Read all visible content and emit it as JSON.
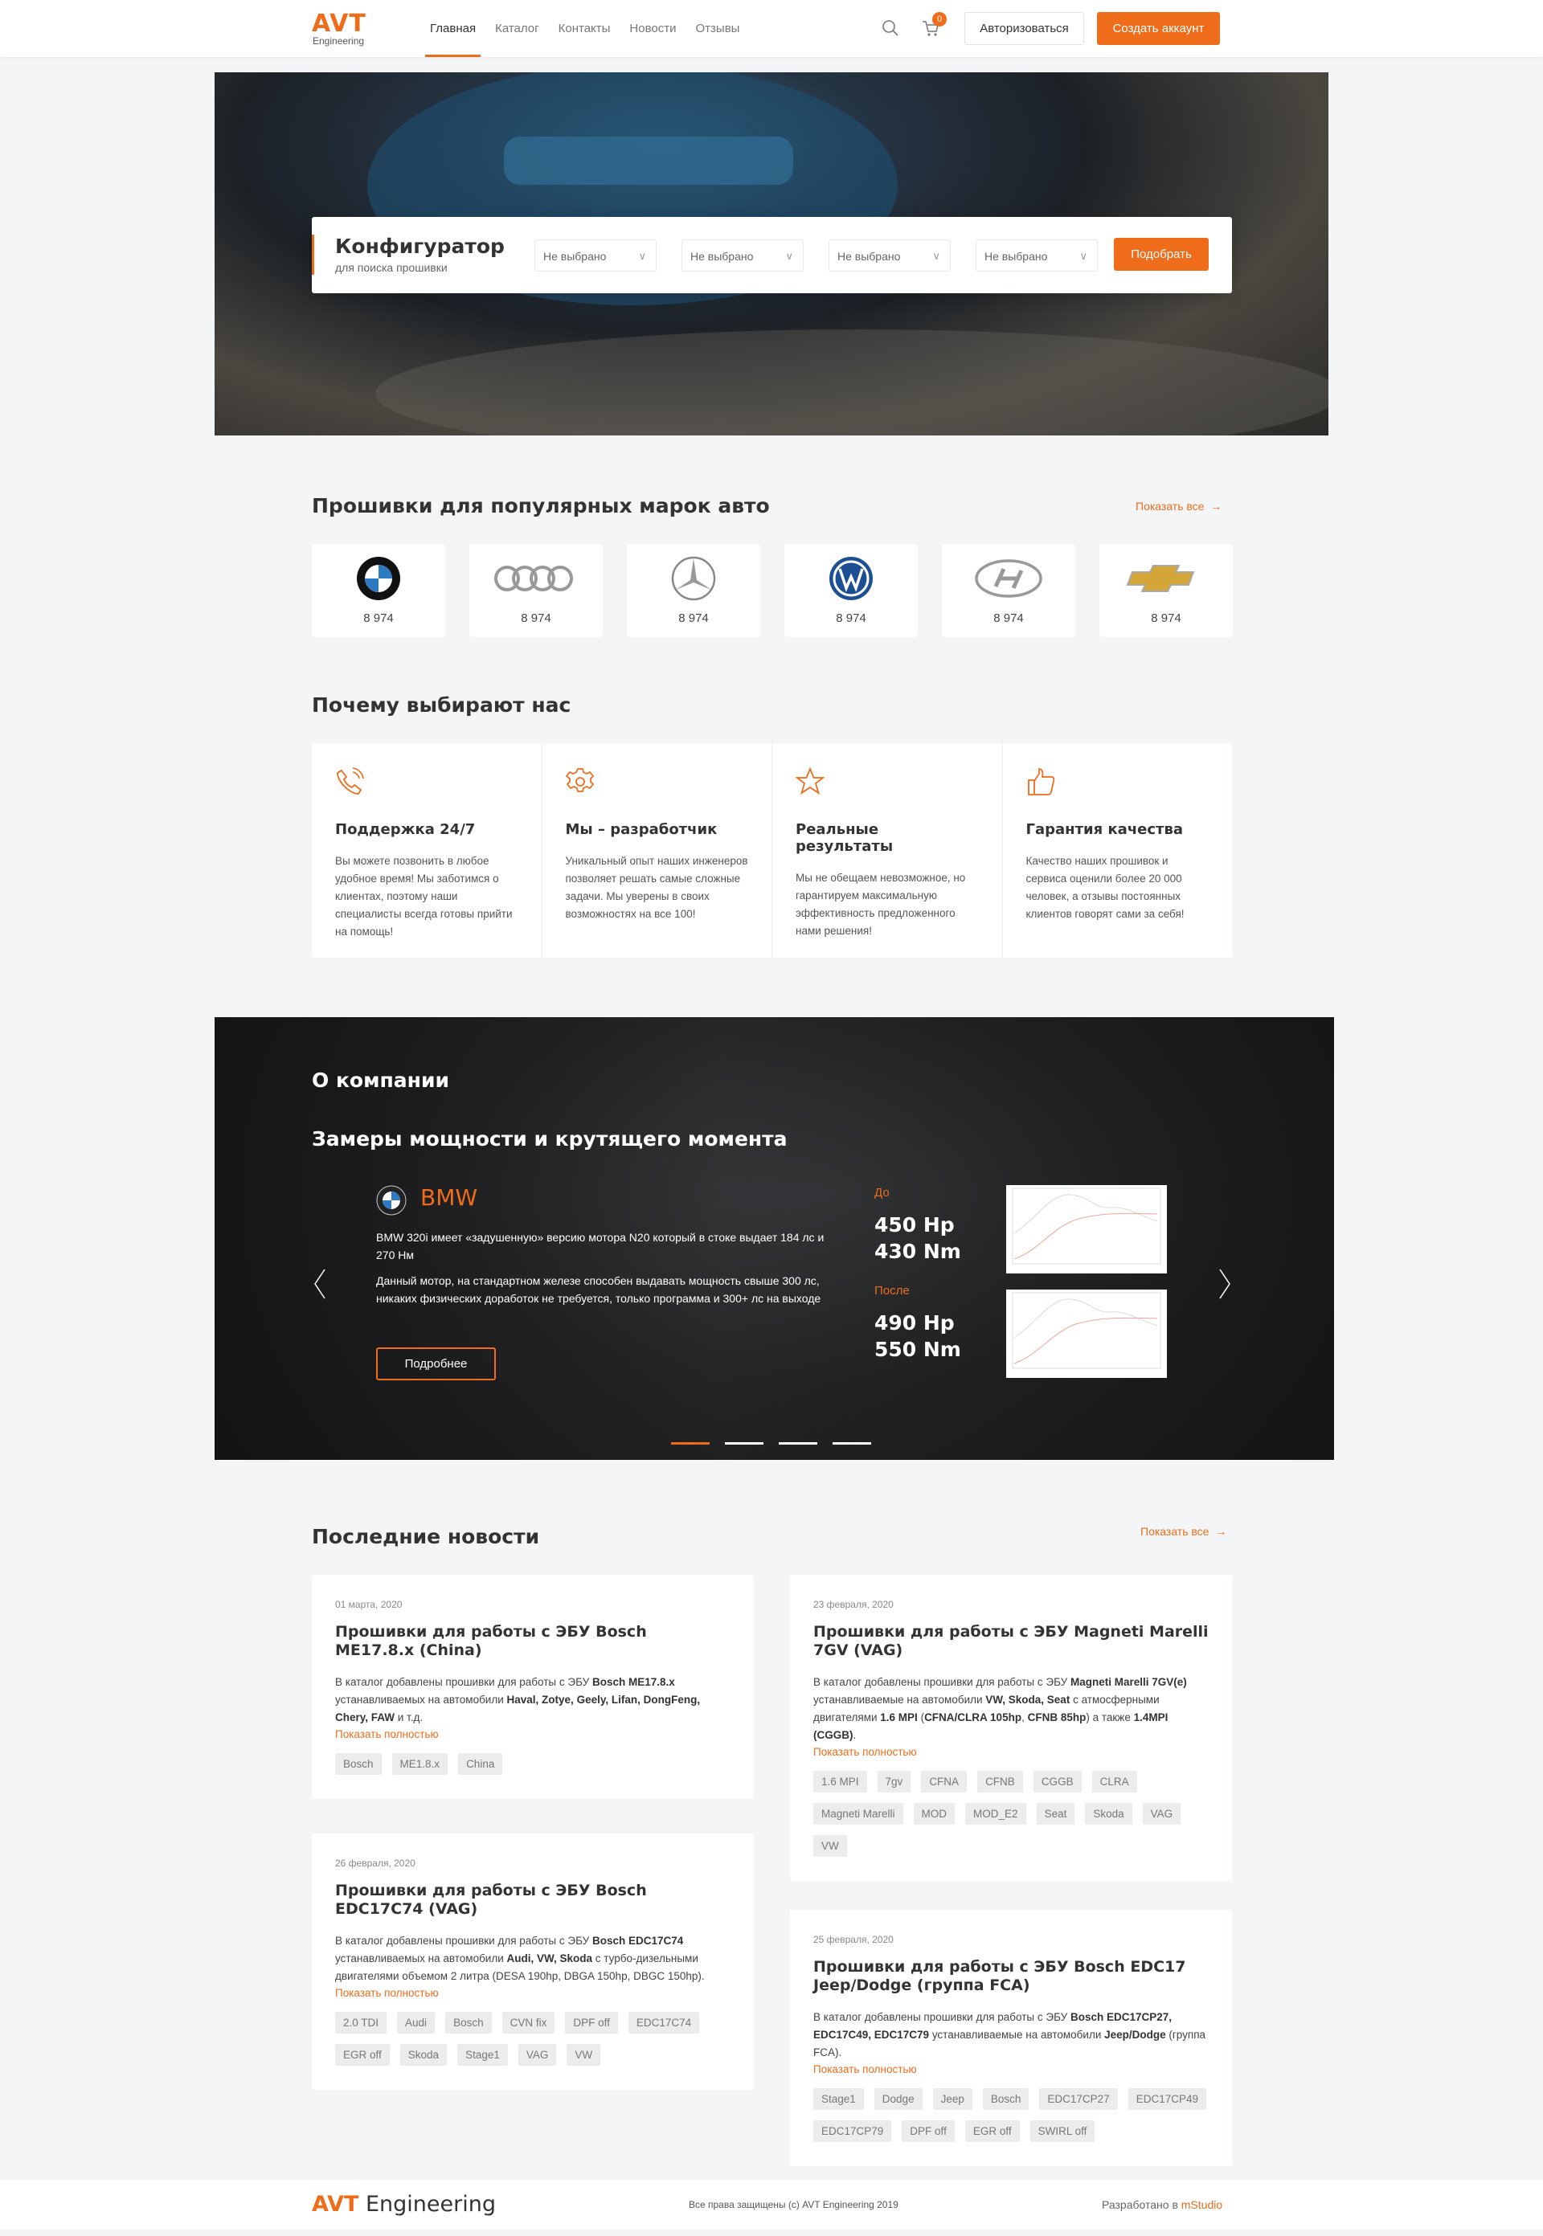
{
  "colors": {
    "accent": "#ef6c1a",
    "background": "#f4f5f7"
  },
  "header": {
    "logo": "AVT",
    "logo_sub": "Engineering",
    "nav": [
      "Главная",
      "Каталог",
      "Контакты",
      "Новости",
      "Отзывы"
    ],
    "active": "Главная",
    "cart_count": "0",
    "login": "Авторизоваться",
    "register": "Создать аккаунт",
    "icons": [
      "search-icon",
      "cart-icon"
    ]
  },
  "configurator": {
    "title": "Конфигуратор",
    "subtitle": "для поиска прошивки",
    "selects": [
      "Не выбрано",
      "Не выбрано",
      "Не выбрано",
      "Не выбрано"
    ],
    "button": "Подобрать"
  },
  "brands": {
    "title": "Прошивки для популярных марок авто",
    "show_all": "Показать все",
    "items": [
      {
        "name": "BMW",
        "count": "8 974"
      },
      {
        "name": "Audi",
        "count": "8 974"
      },
      {
        "name": "Mercedes",
        "count": "8 974"
      },
      {
        "name": "Volkswagen",
        "count": "8 974"
      },
      {
        "name": "Hyundai",
        "count": "8 974"
      },
      {
        "name": "Chevrolet",
        "count": "8 974"
      }
    ]
  },
  "why": {
    "title": "Почему выбирают нас",
    "items": [
      {
        "icon": "phone-icon",
        "title": "Поддержка 24/7",
        "text": "Вы можете позвонить в любое удобное время! Мы заботимся о клиентах, поэтому наши специалисты всегда готовы прийти на помощь!"
      },
      {
        "icon": "gear-icon",
        "title": "Мы – разработчик",
        "text": "Уникальный опыт наших инженеров позволяет решать самые сложные задачи. Мы уверены в своих возможностях на все 100!"
      },
      {
        "icon": "star-icon",
        "title": "Реальные результаты",
        "text": "Мы не обещаем невозможное, но гарантируем максимальную эффективность предложенного нами решения!"
      },
      {
        "icon": "thumbs-up-icon",
        "title": "Гарантия качества",
        "text": "Качество наших прошивок и сервиса оценили более 20 000 человек, а отзывы постоянных клиентов говорят сами за себя!"
      }
    ]
  },
  "about": {
    "title": "О компании",
    "subtitle": "Замеры мощности и крутящего момента",
    "brand": "BMW",
    "p1": "BMW 320i имеет «задушенную» версию мотора N20 который в стоке выдает 184 лс и 270 Нм",
    "p2": "Данный мотор, на стандартном железе способен выдавать мощность свыше 300 лс, никаких физических доработок не требуется, только программа и 300+ лс на выходе",
    "button": "Подробнее",
    "before_label": "До",
    "before_hp": "450 Hp",
    "before_nm": "430 Nm",
    "after_label": "После",
    "after_hp": "490 Hp",
    "after_nm": "550 Nm",
    "slides": 4,
    "active_slide": 1
  },
  "news": {
    "title": "Последние новости",
    "show_all": "Показать все",
    "read_more": "Показать полностью",
    "items": [
      {
        "date": "01 марта, 2020",
        "title": "Прошивки для работы с ЭБУ Bosch ME17.8.x (China)",
        "body": [
          {
            "t": "В каталог добавлены прошивки для работы с ЭБУ "
          },
          {
            "t": "Bosch ME17.8.x",
            "b": true
          },
          {
            "t": " устанавливаемых на автомобили "
          },
          {
            "t": "Haval, Zotye, Geely, Lifan, DongFeng, Chery, FAW",
            "b": true
          },
          {
            "t": " и т.д."
          }
        ],
        "tags": [
          "Bosch",
          "ME1.8.x",
          "China"
        ]
      },
      {
        "date": "23 февраля, 2020",
        "title": "Прошивки для работы с ЭБУ Magneti Marelli 7GV (VAG)",
        "body": [
          {
            "t": "В каталог добавлены прошивки для работы с ЭБУ "
          },
          {
            "t": "Magneti Marelli 7GV(e)",
            "b": true
          },
          {
            "t": " устанавливаемые на автомобили "
          },
          {
            "t": "VW, Skoda, Seat",
            "b": true
          },
          {
            "t": " с атмосферными двигателями "
          },
          {
            "t": "1.6 MPI",
            "b": true
          },
          {
            "t": " ("
          },
          {
            "t": "CFNA/CLRA 105hp",
            "b": true
          },
          {
            "t": ", "
          },
          {
            "t": "CFNB 85hp",
            "b": true
          },
          {
            "t": ") а также "
          },
          {
            "t": "1.4MPI (CGGB)",
            "b": true
          },
          {
            "t": "."
          }
        ],
        "tags": [
          "1.6 MPI",
          "7gv",
          "CFNA",
          "CFNB",
          "CGGB",
          "CLRA",
          "Magneti Marelli",
          "MOD",
          "MOD_E2",
          "Seat",
          "Skoda",
          "VAG",
          "VW"
        ]
      },
      {
        "date": "26 февраля, 2020",
        "title": "Прошивки для работы с ЭБУ Bosch EDC17C74 (VAG)",
        "body": [
          {
            "t": "В каталог добавлены прошивки для работы с ЭБУ "
          },
          {
            "t": "Bosch EDC17C74",
            "b": true
          },
          {
            "t": " устанавливаемых на автомобили "
          },
          {
            "t": "Audi, VW, Skoda",
            "b": true
          },
          {
            "t": " с турбо-дизельными двигателями объемом 2 литра (DESA 190hp, DBGA 150hp, DBGC 150hp)."
          }
        ],
        "tags": [
          "2.0 TDI",
          "Audi",
          "Bosch",
          "CVN fix",
          "DPF off",
          "EDC17C74",
          "EGR off",
          "Skoda",
          "Stage1",
          "VAG",
          "VW"
        ]
      },
      {
        "date": "25 февраля, 2020",
        "title": "Прошивки для работы с ЭБУ Bosch EDC17 Jeep/Dodge (группа FCA)",
        "body": [
          {
            "t": "В каталог добавлены прошивки для работы с ЭБУ "
          },
          {
            "t": "Bosch EDC17CP27, EDC17C49, EDC17C79",
            "b": true
          },
          {
            "t": " устанавливаемые на автомобили "
          },
          {
            "t": "Jeep/Dodge",
            "b": true
          },
          {
            "t": " (группа FCA)."
          }
        ],
        "tags": [
          "Stage1",
          "Dodge",
          "Jeep",
          "Bosch",
          "EDC17CP27",
          "EDC17CP49",
          "EDC17CP79",
          "DPF off",
          "EGR off",
          "SWIRL off"
        ]
      }
    ]
  },
  "footer": {
    "logo_a": "AVT",
    "logo_b": " Engineering",
    "copyright": "Все права защищены (с) AVT Engineering 2019",
    "dev_prefix": "Разработано в ",
    "dev_link": "mStudio"
  }
}
